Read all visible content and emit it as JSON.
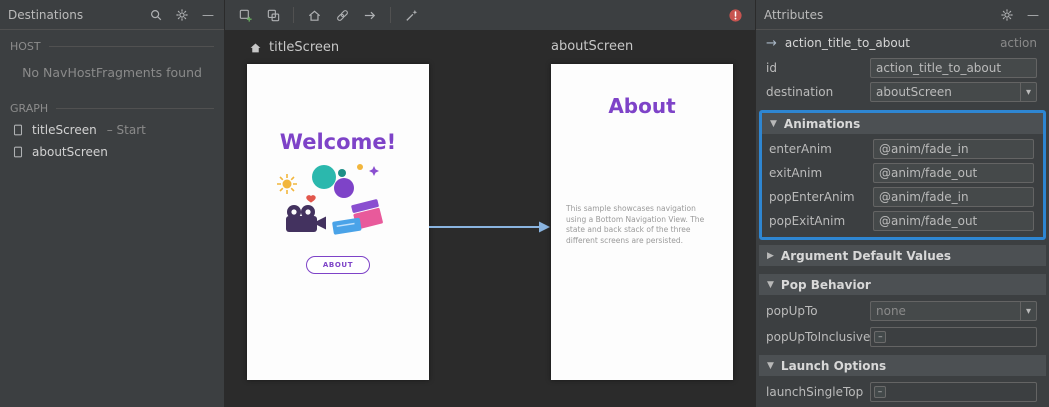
{
  "colors": {
    "accent-blue": "#2e86d2",
    "arrow-blue": "#8ab4e0",
    "brand-purple": "#7e43c8",
    "error-red": "#c75450"
  },
  "icons": {
    "minimize": "—",
    "dropdown_arrow": "▾",
    "checkbox_indeterminate": "–"
  },
  "destinations_panel": {
    "title": "Destinations",
    "host_label": "HOST",
    "host_empty_message": "No NavHostFragments found",
    "graph_label": "GRAPH",
    "items": [
      {
        "label": "titleScreen",
        "suffix": "– Start"
      },
      {
        "label": "aboutScreen",
        "suffix": ""
      }
    ]
  },
  "surface": {
    "screens": [
      {
        "name": "titleScreen",
        "heading": "Welcome!",
        "button_label": "ABOUT"
      },
      {
        "name": "aboutScreen",
        "heading": "About",
        "body": "This sample showcases navigation using a Bottom Navigation View. The state and back stack of the three different screens are persisted."
      }
    ]
  },
  "attributes_panel": {
    "title": "Attributes",
    "action_arrow": "→",
    "action_name": "action_title_to_about",
    "action_type": "action",
    "id_label": "id",
    "id_value": "action_title_to_about",
    "destination_label": "destination",
    "destination_value": "aboutScreen",
    "sections": {
      "animations": {
        "icon": "▼",
        "label": "Animations"
      },
      "arguments": {
        "icon": "▶",
        "label": "Argument Default Values"
      },
      "pop_behavior": {
        "icon": "▼",
        "label": "Pop Behavior"
      },
      "launch_options": {
        "icon": "▼",
        "label": "Launch Options"
      }
    },
    "animation_rows": [
      {
        "label": "enterAnim",
        "value": "@anim/fade_in"
      },
      {
        "label": "exitAnim",
        "value": "@anim/fade_out"
      },
      {
        "label": "popEnterAnim",
        "value": "@anim/fade_in"
      },
      {
        "label": "popExitAnim",
        "value": "@anim/fade_out"
      }
    ],
    "pop_up_to_label": "popUpTo",
    "pop_up_to_value": "none",
    "pop_up_to_inclusive_label": "popUpToInclusive",
    "launch_single_top_label": "launchSingleTop"
  }
}
